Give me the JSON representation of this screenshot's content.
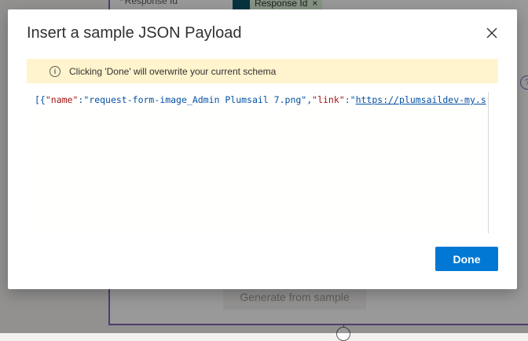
{
  "background": {
    "field_required_mark": "*",
    "field_label": "Response Id",
    "token_label": "Response Id",
    "token_remove": "×",
    "help_glyph": "?",
    "generate_button": "Generate from sample"
  },
  "dialog": {
    "title": "Insert a sample JSON Payload",
    "close_glyph": "✕",
    "warning_icon_glyph": "i",
    "warning_text": "Clicking 'Done' will overwrite your current schema",
    "editor": {
      "tokens": {
        "open": "[{",
        "key_name": "\"name\"",
        "colon1": ":",
        "val_name": "\"request-form-image_Admin Plumsail 7.png\"",
        "comma1": ",",
        "key_link": "\"link\"",
        "colon2": ":",
        "val_link_quote": "\"",
        "val_link": "https://plumsaildev-my.s"
      }
    },
    "done_button": "Done"
  },
  "colors": {
    "accent": "#0078d4",
    "warning_bg": "#fff4ce",
    "json_key": "#a31515",
    "json_value": "#0451a5",
    "flow_border": "#8764b8"
  }
}
